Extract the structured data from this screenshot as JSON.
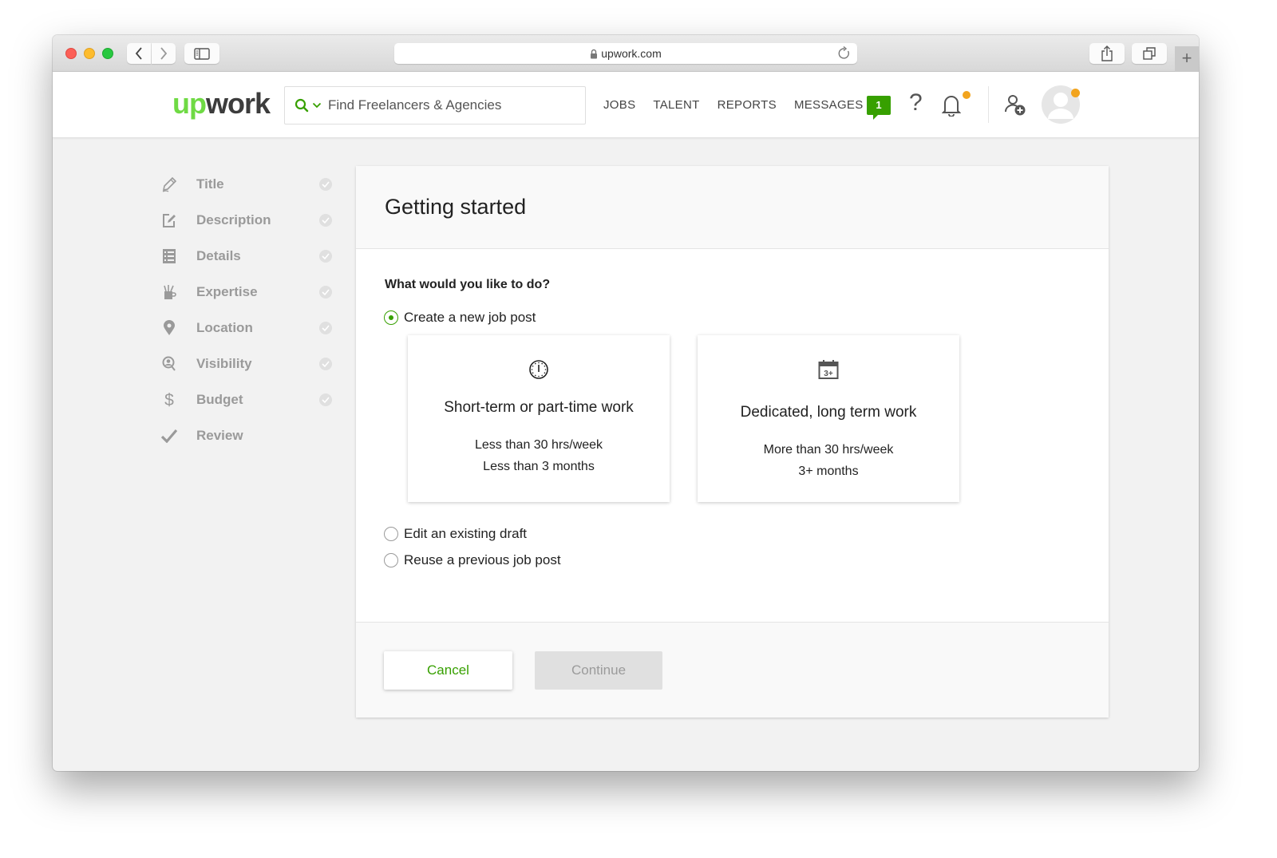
{
  "browser": {
    "url": "upwork.com",
    "new_tab_label": "+"
  },
  "header": {
    "logo_up": "up",
    "logo_work": "work",
    "search": {
      "placeholder": "Find Freelancers & Agencies",
      "value": ""
    },
    "nav": [
      "JOBS",
      "TALENT",
      "REPORTS",
      "MESSAGES"
    ],
    "messages_badge": "1",
    "help_label": "?"
  },
  "colors": {
    "brand_green": "#37a000",
    "logo_green": "#6fda44",
    "notification_dot": "#f2a41e"
  },
  "steps": [
    {
      "label": "Title",
      "icon": "pencil-icon",
      "completed": true
    },
    {
      "label": "Description",
      "icon": "edit-icon",
      "completed": true
    },
    {
      "label": "Details",
      "icon": "list-icon",
      "completed": true
    },
    {
      "label": "Expertise",
      "icon": "tools-mug-icon",
      "completed": true
    },
    {
      "label": "Location",
      "icon": "map-pin-icon",
      "completed": true
    },
    {
      "label": "Visibility",
      "icon": "search-person-icon",
      "completed": true
    },
    {
      "label": "Budget",
      "icon": "dollar-icon",
      "completed": true
    },
    {
      "label": "Review",
      "icon": "checkmark-icon",
      "completed": false
    }
  ],
  "card": {
    "title": "Getting started",
    "question": "What would you like to do?",
    "options": [
      {
        "label": "Create a new job post",
        "selected": true
      },
      {
        "label": "Edit an existing draft",
        "selected": false
      },
      {
        "label": "Reuse a previous job post",
        "selected": false
      }
    ],
    "work_types": [
      {
        "icon": "clock-icon",
        "title": "Short-term or part-time work",
        "lines": [
          "Less than 30 hrs/week",
          "Less than 3 months"
        ]
      },
      {
        "icon": "calendar-icon",
        "icon_text": "3+",
        "title": "Dedicated, long term work",
        "lines": [
          "More than 30 hrs/week",
          "3+ months"
        ]
      }
    ],
    "buttons": {
      "cancel": "Cancel",
      "continue": "Continue"
    }
  }
}
